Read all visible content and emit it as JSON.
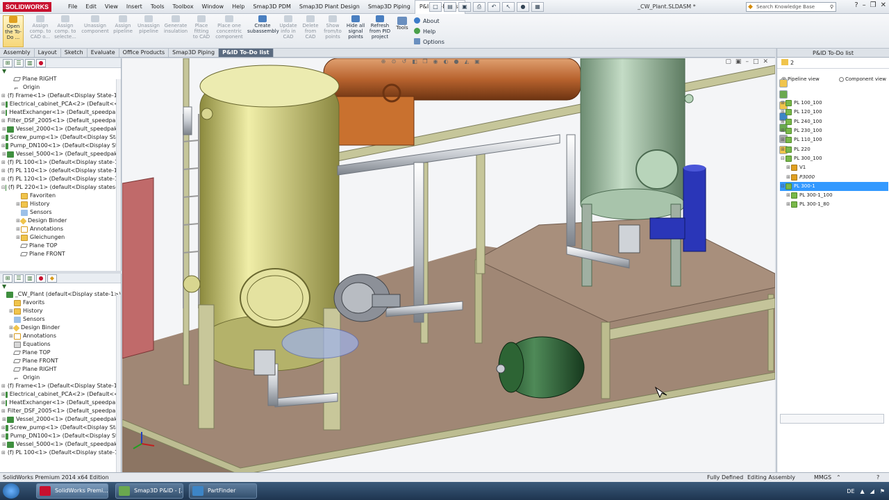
{
  "app": {
    "logo": "SOLIDWORKS",
    "document_title": "_CW_Plant.SLDASM *"
  },
  "menu": [
    "File",
    "Edit",
    "View",
    "Insert",
    "Tools",
    "Toolbox",
    "Window",
    "Help",
    "Smap3D PDM",
    "Smap3D Plant Design",
    "Smap3D Piping",
    "P&ID To-Do list"
  ],
  "search": {
    "placeholder": "Search Knowledge Base"
  },
  "commands": [
    {
      "label": "Open the To-Do ...",
      "enabled": true
    },
    {
      "label": "Assign comp. to CAD o...",
      "enabled": false
    },
    {
      "label": "Assign comp. to selecte...",
      "enabled": false
    },
    {
      "label": "Unassign component",
      "enabled": false
    },
    {
      "label": "Assign pipeline",
      "enabled": false
    },
    {
      "label": "Unassign pipeline",
      "enabled": false
    },
    {
      "label": "Generate insulation",
      "enabled": false
    },
    {
      "label": "Place fitting to CAD",
      "enabled": false
    },
    {
      "label": "Place one concentric component",
      "enabled": false
    },
    {
      "label": "Create subassembly",
      "enabled": true
    },
    {
      "label": "Update info in CAD",
      "enabled": false
    },
    {
      "label": "Delete from CAD",
      "enabled": false
    },
    {
      "label": "Show from/to points",
      "enabled": false
    },
    {
      "label": "Hide all signal points",
      "enabled": true
    },
    {
      "label": "Refresh from PID project",
      "enabled": true
    }
  ],
  "tools_label": "Tools",
  "help_links": [
    "About",
    "Help",
    "Options"
  ],
  "cm_tabs": [
    "Assembly",
    "Layout",
    "Sketch",
    "Evaluate",
    "Office Products",
    "Smap3D Piping",
    "P&ID To-Do list"
  ],
  "tree1": [
    {
      "label": "Plane RIGHT",
      "icon": "plane",
      "indent": 1
    },
    {
      "label": "Origin",
      "icon": "origin",
      "indent": 1
    },
    {
      "label": "(f) Frame<1> (Default<Display State-1>",
      "icon": "comp",
      "indent": 0,
      "exp": "+"
    },
    {
      "label": "Electrical_cabinet_PCA<2> (Default<<[",
      "icon": "comp",
      "indent": 0,
      "exp": "+"
    },
    {
      "label": "HeatExchanger<1> (Default_speedpak)",
      "icon": "comp",
      "indent": 0,
      "exp": "+"
    },
    {
      "label": "Filter_DSF_2005<1> (Default_speedpak)",
      "icon": "comp",
      "indent": 0,
      "exp": "+"
    },
    {
      "label": "Vessel_2000<1> (Default_speedpak)",
      "icon": "comp",
      "indent": 0,
      "exp": "+"
    },
    {
      "label": "Screw_pump<1> (Default<Display Stat",
      "icon": "comp",
      "indent": 0,
      "exp": "+"
    },
    {
      "label": "Pump_DN100<1> (Default<Display Sta",
      "icon": "comp",
      "indent": 0,
      "exp": "+"
    },
    {
      "label": "Vessel_5000<1> (Default_speedpak)",
      "icon": "comp",
      "indent": 0,
      "exp": "+"
    },
    {
      "label": "(f) PL 100<1> (Default<Display state-1>",
      "icon": "comp",
      "indent": 0,
      "exp": "+"
    },
    {
      "label": "(f) PL 110<1> (default<Display state-1>",
      "icon": "comp",
      "indent": 0,
      "exp": "+"
    },
    {
      "label": "(f) PL 120<1> (Default<Display state-1>",
      "icon": "comp",
      "indent": 0,
      "exp": "+"
    },
    {
      "label": "(f) PL 220<1> (default<Display states-1",
      "icon": "comp",
      "indent": 0,
      "exp": "-"
    },
    {
      "label": "Favoriten",
      "icon": "folder",
      "indent": 2
    },
    {
      "label": "History",
      "icon": "folder",
      "indent": 2,
      "exp": "+"
    },
    {
      "label": "Sensors",
      "icon": "sensor",
      "indent": 2
    },
    {
      "label": "Design Binder",
      "icon": "binder",
      "indent": 2,
      "exp": "+"
    },
    {
      "label": "Annotations",
      "icon": "annot",
      "indent": 2,
      "exp": "+"
    },
    {
      "label": "Gleichungen",
      "icon": "folder",
      "indent": 2,
      "exp": "+"
    },
    {
      "label": "Plane TOP",
      "icon": "plane",
      "indent": 2
    },
    {
      "label": "Plane FRONT",
      "icon": "plane",
      "indent": 2
    }
  ],
  "tree2": [
    {
      "label": "_CW_Plant  (default<Display state-1>)",
      "icon": "root",
      "indent": 0,
      "exp": ""
    },
    {
      "label": "Favorits",
      "icon": "folder",
      "indent": 1
    },
    {
      "label": "History",
      "icon": "folder",
      "indent": 1,
      "exp": "+"
    },
    {
      "label": "Sensors",
      "icon": "sensor",
      "indent": 1
    },
    {
      "label": "Design Binder",
      "icon": "binder",
      "indent": 1,
      "exp": "+"
    },
    {
      "label": "Annotations",
      "icon": "annot",
      "indent": 1,
      "exp": "+"
    },
    {
      "label": "Equations",
      "icon": "equ",
      "indent": 1
    },
    {
      "label": "Plane TOP",
      "icon": "plane",
      "indent": 1
    },
    {
      "label": "Plane FRONT",
      "icon": "plane",
      "indent": 1
    },
    {
      "label": "Plane RIGHT",
      "icon": "plane",
      "indent": 1
    },
    {
      "label": "Origin",
      "icon": "origin",
      "indent": 1
    },
    {
      "label": "(f) Frame<1> (Default<Display State-1>",
      "icon": "comp",
      "indent": 0,
      "exp": "+"
    },
    {
      "label": "Electrical_cabinet_PCA<2> (Default<<[",
      "icon": "comp",
      "indent": 0,
      "exp": "+"
    },
    {
      "label": "HeatExchanger<1> (Default_speedpak)",
      "icon": "comp",
      "indent": 0,
      "exp": "+"
    },
    {
      "label": "Filter_DSF_2005<1> (Default_speedpak)",
      "icon": "comp",
      "indent": 0,
      "exp": "+"
    },
    {
      "label": "Vessel_2000<1> (Default_speedpak)",
      "icon": "comp",
      "indent": 0,
      "exp": "+"
    },
    {
      "label": "Screw_pump<1> (Default<Display Stat",
      "icon": "comp",
      "indent": 0,
      "exp": "+"
    },
    {
      "label": "Pump_DN100<1> (Default<Display Sta",
      "icon": "comp",
      "indent": 0,
      "exp": "+"
    },
    {
      "label": "Vessel_5000<1> (Default_speedpak)",
      "icon": "comp",
      "indent": 0,
      "exp": "+"
    },
    {
      "label": "(f) PL 100<1> (Default<Display state-1>",
      "icon": "comp",
      "indent": 0,
      "exp": "+"
    }
  ],
  "right_panel": {
    "title": "P&ID To-Do list",
    "count": "2",
    "views": [
      "Pipeline view",
      "Component view"
    ],
    "items": [
      {
        "label": "PL 100_100",
        "exp": "+",
        "indent": 0
      },
      {
        "label": "PL 120_100",
        "exp": "+",
        "indent": 0
      },
      {
        "label": "PL 240_100",
        "exp": "+",
        "indent": 0
      },
      {
        "label": "PL 230_100",
        "exp": "+",
        "indent": 0
      },
      {
        "label": "PL 110_100",
        "exp": "+",
        "indent": 0
      },
      {
        "label": "PL 220",
        "exp": "+",
        "indent": 0
      },
      {
        "label": "PL 300_100",
        "exp": "-",
        "indent": 0
      },
      {
        "label": "V1",
        "exp": "+",
        "indent": 1,
        "open": true
      },
      {
        "label": "P3000",
        "exp": "+",
        "indent": 1,
        "open": true,
        "italic": true
      },
      {
        "label": "PL 300-1",
        "exp": "-",
        "indent": 0,
        "selected": true
      },
      {
        "label": "PL 300-1_100",
        "exp": "+",
        "indent": 1
      },
      {
        "label": "PL 300-1_80",
        "exp": "+",
        "indent": 1
      }
    ]
  },
  "status": {
    "edition": "SolidWorks Premium 2014 x64 Edition",
    "state": "Fully Defined",
    "mode": "Editing Assembly",
    "units": "MMGS"
  },
  "taskbar": [
    {
      "label": "SolidWorks Premi...",
      "color": "#c8102e"
    },
    {
      "label": "Smap3D P&ID - [...",
      "color": "#6aa84f"
    },
    {
      "label": "PartFinder",
      "color": "#3d85c6"
    }
  ],
  "tray": {
    "lang": "DE"
  },
  "colors": {
    "accent": "#3399ff",
    "brand": "#c8102e"
  }
}
